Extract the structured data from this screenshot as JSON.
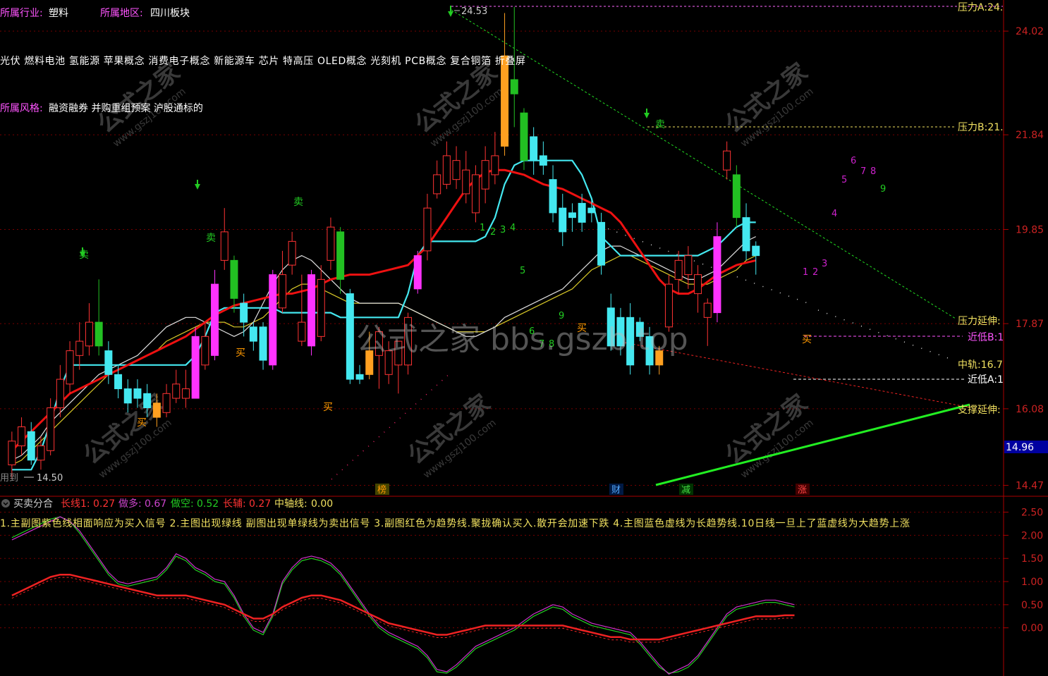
{
  "info": {
    "industry_label": "所属行业:",
    "industry_value": "塑料",
    "region_label": "所属地区:",
    "region_value": "四川板块",
    "concepts": "光伏 燃料电池 氢能源 苹果概念 消费电子概念 新能源车 芯片 特高压 OLED概念 光刻机 PCB概念 复合铜箔 折叠屏",
    "style_label": "所属风格:",
    "style_value": "融资融券 并购重组预案 沪股通标的"
  },
  "colors": {
    "background": "#000000",
    "up_candle": "#ff3333",
    "down_candle": "#44e8f0",
    "buy_bar": "#ff33ff",
    "sell_bar": "#22c022",
    "orange_bar": "#ffa020",
    "ma_red": "#ee1111",
    "ma_cyan": "#44e8f0",
    "ma_white": "#e0e0e0",
    "ma_yellow": "#d8c828",
    "support_green": "#22ee22",
    "axis_red": "#aa0000"
  },
  "main_axis": {
    "ticks": [
      "24.02",
      "21.84",
      "19.85",
      "17.87",
      "16.08",
      "14.47"
    ],
    "current_price": "14.96",
    "top_label": "压力A:24."
  },
  "levels": {
    "pressure_b": "压力B:21.",
    "pressure_ext": "压力延伸:",
    "near_low_b": "近低B:1",
    "mid_rail": "中轨:16.7",
    "near_low_a": "近低A:1",
    "support_ext": "支撑延伸:"
  },
  "annotations": {
    "peak": "24.53",
    "low": "14.50",
    "low_prefix": "用到",
    "buy": "买",
    "sell": "卖",
    "events": [
      "榜",
      "财",
      "减",
      "涨"
    ],
    "green_counts": [
      "1",
      "2",
      "3",
      "4",
      "5",
      "6",
      "7",
      "8",
      "9"
    ],
    "magenta_counts": [
      "1",
      "2",
      "3",
      "4",
      "5",
      "6",
      "7",
      "8",
      "9"
    ]
  },
  "watermarks": {
    "center": "公式之家 bbs.gszb.top",
    "brand": "公式之家",
    "url": "www.gszj100.com"
  },
  "sub_panel": {
    "title": "买卖分合",
    "long_line_label": "长线1:",
    "long_line_value": "0.27",
    "do_long_label": "做多:",
    "do_long_value": "0.67",
    "do_short_label": "做空:",
    "do_short_value": "0.52",
    "long_aux_label": "长辅:",
    "long_aux_value": "0.27",
    "mid_axis_label": "中轴线:",
    "mid_axis_value": "0.00",
    "description": "1.主副图紫色线相面响应为买入信号 2.主图出现绿线 副图出现单绿线为卖出信号 3.副图红色为趋势线.聚拢确认买入.散开会加速下跌 4.主图蓝色虚线为长趋势线.10日线一旦上了蓝虚线为大趋势上涨",
    "ticks": [
      "2.50",
      "2.00",
      "1.50",
      "1.00",
      "0.50",
      "0.00"
    ]
  },
  "chart_data": {
    "type": "candlestick",
    "price_range": [
      14.3,
      24.6
    ],
    "sub_range": [
      -0.98,
      2.6
    ],
    "n_bars": 78,
    "candles": [
      [
        14.9,
        15.4,
        15.6,
        14.6,
        "u"
      ],
      [
        15.3,
        15.7,
        15.9,
        15.1,
        "u"
      ],
      [
        15.6,
        15.0,
        15.8,
        14.9,
        "d"
      ],
      [
        15.0,
        15.3,
        15.5,
        14.8,
        "u"
      ],
      [
        15.2,
        16.1,
        16.3,
        15.1,
        "u"
      ],
      [
        16.1,
        16.7,
        17.0,
        15.9,
        "u"
      ],
      [
        16.6,
        17.3,
        17.5,
        16.4,
        "u"
      ],
      [
        17.2,
        17.5,
        17.9,
        16.9,
        "u"
      ],
      [
        17.4,
        17.9,
        18.3,
        17.2,
        "u"
      ],
      [
        17.9,
        17.4,
        18.8,
        17.2,
        "s"
      ],
      [
        17.3,
        16.8,
        17.5,
        16.6,
        "d"
      ],
      [
        16.8,
        16.5,
        17.0,
        16.3,
        "d"
      ],
      [
        16.5,
        16.2,
        16.7,
        16.0,
        "d"
      ],
      [
        16.3,
        16.5,
        16.7,
        16.1,
        "d"
      ],
      [
        16.4,
        16.1,
        16.6,
        15.9,
        "d"
      ],
      [
        16.2,
        15.9,
        16.4,
        15.7,
        "o"
      ],
      [
        16.0,
        16.4,
        16.6,
        15.9,
        "u"
      ],
      [
        16.3,
        16.6,
        16.9,
        16.2,
        "u"
      ],
      [
        16.5,
        16.3,
        16.9,
        16.1,
        "u"
      ],
      [
        16.3,
        17.6,
        17.8,
        16.3,
        "b"
      ],
      [
        17.0,
        17.6,
        17.9,
        16.9,
        "u"
      ],
      [
        17.2,
        18.7,
        19.0,
        17.1,
        "b"
      ],
      [
        19.2,
        19.8,
        20.3,
        19.0,
        "u"
      ],
      [
        19.2,
        18.4,
        19.3,
        18.1,
        "s"
      ],
      [
        18.3,
        17.9,
        18.5,
        17.6,
        "d"
      ],
      [
        17.8,
        17.5,
        17.9,
        17.3,
        "d"
      ],
      [
        17.8,
        17.1,
        17.9,
        16.9,
        "d"
      ],
      [
        17.0,
        18.9,
        19.0,
        16.9,
        "b"
      ],
      [
        18.2,
        18.9,
        19.4,
        18.1,
        "u"
      ],
      [
        19.1,
        19.6,
        19.8,
        18.9,
        "u"
      ],
      [
        17.9,
        17.5,
        18.9,
        17.4,
        "u"
      ],
      [
        17.4,
        18.9,
        19.0,
        17.2,
        "b"
      ],
      [
        17.6,
        18.8,
        19.1,
        17.5,
        "u"
      ],
      [
        19.2,
        19.9,
        20.1,
        19.0,
        "u"
      ],
      [
        19.8,
        18.8,
        19.9,
        18.5,
        "s"
      ],
      [
        18.5,
        16.7,
        18.6,
        16.6,
        "d"
      ],
      [
        16.7,
        16.8,
        17.0,
        16.6,
        "d"
      ],
      [
        16.8,
        17.3,
        17.7,
        16.7,
        "o"
      ],
      [
        17.2,
        17.7,
        17.8,
        16.5,
        "u"
      ],
      [
        17.3,
        16.8,
        17.5,
        16.6,
        "u"
      ],
      [
        17.5,
        17.0,
        17.5,
        16.4,
        "u"
      ],
      [
        17.0,
        18.0,
        18.1,
        16.8,
        "u"
      ],
      [
        19.3,
        18.6,
        19.4,
        18.5,
        "b"
      ],
      [
        19.4,
        20.3,
        20.6,
        19.2,
        "u"
      ],
      [
        20.6,
        21.0,
        21.3,
        20.5,
        "u"
      ],
      [
        20.8,
        21.4,
        21.7,
        20.7,
        "u"
      ],
      [
        21.3,
        20.9,
        21.6,
        20.7,
        "u"
      ],
      [
        20.6,
        21.1,
        21.5,
        20.4,
        "u"
      ],
      [
        21.0,
        20.2,
        21.2,
        20.0,
        "u"
      ],
      [
        20.7,
        21.3,
        21.6,
        20.4,
        "u"
      ],
      [
        21.0,
        21.4,
        21.9,
        20.8,
        "u"
      ],
      [
        21.6,
        23.5,
        24.4,
        21.4,
        "o"
      ],
      [
        23.0,
        22.7,
        24.53,
        22.0,
        "s"
      ],
      [
        22.3,
        21.3,
        22.4,
        21.1,
        "s"
      ],
      [
        21.8,
        21.3,
        22.0,
        21.0,
        "d"
      ],
      [
        21.4,
        21.2,
        21.7,
        21.0,
        "d"
      ],
      [
        20.9,
        20.2,
        21.2,
        20.0,
        "d"
      ],
      [
        20.3,
        19.8,
        20.6,
        19.5,
        "d"
      ],
      [
        20.2,
        20.1,
        20.4,
        19.8,
        "d"
      ],
      [
        20.4,
        20.0,
        20.6,
        19.8,
        "d"
      ],
      [
        20.2,
        20.3,
        20.5,
        20.0,
        "d"
      ],
      [
        20.0,
        19.1,
        20.2,
        18.9,
        "d"
      ],
      [
        18.2,
        17.4,
        18.5,
        17.3,
        "d"
      ],
      [
        18.0,
        17.4,
        18.2,
        17.2,
        "d"
      ],
      [
        18.0,
        17.0,
        18.3,
        16.8,
        "d"
      ],
      [
        17.9,
        17.6,
        18.0,
        17.5,
        "d"
      ],
      [
        17.6,
        17.0,
        17.8,
        16.8,
        "d"
      ],
      [
        17.0,
        17.3,
        17.4,
        16.8,
        "o"
      ],
      [
        17.8,
        18.7,
        18.9,
        17.7,
        "u"
      ],
      [
        18.8,
        19.2,
        19.4,
        18.5,
        "u"
      ],
      [
        18.9,
        19.3,
        19.5,
        18.6,
        "u"
      ],
      [
        18.9,
        18.5,
        19.1,
        18.1,
        "u"
      ],
      [
        18.3,
        18.0,
        18.4,
        17.4,
        "u"
      ],
      [
        18.1,
        19.7,
        20.0,
        17.9,
        "b"
      ],
      [
        21.1,
        21.5,
        21.7,
        20.9,
        "u"
      ],
      [
        21.0,
        20.1,
        21.2,
        19.9,
        "s"
      ],
      [
        20.1,
        19.4,
        20.4,
        19.2,
        "d"
      ],
      [
        19.5,
        19.3,
        19.6,
        18.9,
        "d"
      ]
    ],
    "ma_red": [
      15.2,
      15.4,
      15.6,
      15.8,
      16.0,
      16.2,
      16.4,
      16.5,
      16.6,
      16.7,
      16.8,
      16.9,
      17.0,
      17.1,
      17.2,
      17.3,
      17.4,
      17.5,
      17.6,
      17.75,
      17.9,
      18.05,
      18.15,
      18.25,
      18.3,
      18.35,
      18.4,
      18.45,
      18.5,
      18.5,
      18.55,
      18.6,
      18.7,
      18.8,
      18.85,
      18.9,
      18.9,
      18.9,
      18.95,
      19.0,
      19.05,
      19.1,
      19.3,
      19.5,
      19.8,
      20.1,
      20.4,
      20.7,
      20.9,
      21.05,
      21.1,
      21.1,
      21.05,
      21.0,
      20.9,
      20.8,
      20.75,
      20.7,
      20.6,
      20.5,
      20.4,
      20.3,
      20.2,
      20.0,
      19.7,
      19.4,
      19.1,
      18.8,
      18.6,
      18.5,
      18.5,
      18.6,
      18.75,
      18.9,
      19.0,
      19.1,
      19.15,
      19.2
    ],
    "ma_cyan": [
      14.8,
      14.8,
      14.8,
      15.2,
      15.8,
      16.5,
      17.0,
      17.0,
      17.0,
      17.0,
      17.0,
      17.0,
      17.0,
      17.0,
      17.0,
      17.0,
      17.0,
      17.0,
      17.0,
      17.2,
      17.6,
      18.1,
      18.2,
      18.2,
      18.2,
      18.2,
      18.2,
      18.2,
      18.1,
      18.1,
      18.1,
      18.1,
      18.1,
      18.1,
      18.0,
      18.0,
      18.0,
      18.0,
      18.0,
      18.0,
      18.0,
      18.5,
      19.3,
      19.6,
      19.6,
      19.6,
      19.6,
      19.6,
      19.6,
      19.7,
      20.1,
      20.8,
      21.2,
      21.3,
      21.3,
      21.3,
      21.3,
      21.3,
      21.3,
      21.0,
      20.5,
      19.7,
      19.5,
      19.3,
      19.3,
      19.3,
      19.3,
      19.3,
      19.3,
      19.3,
      19.3,
      19.3,
      19.4,
      19.5,
      19.7,
      19.9,
      20.0,
      20.0
    ],
    "ma_white": [
      15.0,
      15.1,
      15.3,
      15.5,
      15.8,
      16.0,
      16.2,
      16.4,
      16.6,
      16.8,
      16.9,
      17.0,
      17.1,
      17.2,
      17.4,
      17.6,
      17.8,
      17.9,
      18.0,
      18.0,
      17.9,
      17.8,
      17.7,
      17.6,
      17.7,
      17.9,
      18.3,
      18.7,
      19.0,
      19.2,
      19.3,
      19.2,
      19.0,
      18.8,
      18.6,
      18.4,
      18.3,
      18.3,
      18.3,
      18.3,
      18.3,
      18.2,
      18.1,
      18.0,
      17.9,
      17.8,
      17.7,
      17.6,
      17.6,
      17.7,
      17.8,
      18.0,
      18.1,
      18.2,
      18.3,
      18.4,
      18.5,
      18.6,
      18.8,
      19.0,
      19.2,
      19.4,
      19.5,
      19.5,
      19.4,
      19.3,
      19.2,
      19.1,
      19.0,
      18.9,
      18.8,
      18.8,
      18.9,
      19.0,
      19.2,
      19.4,
      19.6,
      19.7
    ],
    "ma_yellow": [
      14.9,
      15.0,
      15.2,
      15.4,
      15.6,
      15.8,
      16.0,
      16.2,
      16.4,
      16.6,
      16.8,
      16.9,
      17.0,
      17.1,
      17.2,
      17.3,
      17.5,
      17.6,
      17.7,
      17.8,
      17.9,
      17.9,
      17.9,
      17.8,
      17.8,
      17.9,
      18.0,
      18.2,
      18.4,
      18.6,
      18.7,
      18.7,
      18.6,
      18.5,
      18.4,
      18.3,
      18.3,
      18.3,
      18.3,
      18.3,
      18.3,
      18.2,
      18.1,
      18.0,
      17.9,
      17.8,
      17.7,
      17.7,
      17.7,
      17.7,
      17.8,
      17.9,
      18.0,
      18.1,
      18.2,
      18.3,
      18.4,
      18.5,
      18.6,
      18.8,
      19.0,
      19.1,
      19.2,
      19.3,
      19.3,
      19.2,
      19.1,
      19.0,
      18.9,
      18.8,
      18.7,
      18.7,
      18.7,
      18.8,
      18.9,
      19.0,
      19.2,
      19.3
    ],
    "sub_magenta": [
      1.9,
      2.0,
      2.1,
      2.2,
      2.3,
      2.4,
      2.3,
      2.1,
      1.8,
      1.5,
      1.2,
      1.0,
      0.95,
      1.0,
      1.05,
      1.1,
      1.3,
      1.6,
      1.5,
      1.3,
      1.2,
      1.05,
      1.0,
      0.7,
      0.3,
      0.0,
      -0.1,
      0.3,
      1.0,
      1.3,
      1.5,
      1.55,
      1.5,
      1.4,
      1.2,
      0.9,
      0.6,
      0.3,
      0.05,
      -0.1,
      -0.2,
      -0.3,
      -0.4,
      -0.6,
      -0.9,
      -0.95,
      -0.8,
      -0.6,
      -0.4,
      -0.3,
      -0.2,
      -0.1,
      0.0,
      0.15,
      0.3,
      0.4,
      0.5,
      0.45,
      0.3,
      0.2,
      0.1,
      0.05,
      0.0,
      -0.05,
      -0.1,
      -0.3,
      -0.55,
      -0.8,
      -1.0,
      -0.9,
      -0.8,
      -0.6,
      -0.3,
      0.0,
      0.3,
      0.45,
      0.5,
      0.55,
      0.6,
      0.6,
      0.55,
      0.5
    ],
    "sub_green": [
      1.95,
      2.05,
      2.15,
      2.25,
      2.35,
      2.4,
      2.3,
      2.05,
      1.75,
      1.45,
      1.15,
      0.95,
      0.9,
      0.95,
      1.0,
      1.05,
      1.25,
      1.55,
      1.45,
      1.25,
      1.15,
      1.0,
      0.95,
      0.65,
      0.25,
      -0.05,
      -0.15,
      0.25,
      0.95,
      1.25,
      1.45,
      1.5,
      1.45,
      1.35,
      1.15,
      0.85,
      0.55,
      0.25,
      0.0,
      -0.15,
      -0.25,
      -0.35,
      -0.45,
      -0.65,
      -0.95,
      -0.98,
      -0.85,
      -0.65,
      -0.45,
      -0.35,
      -0.25,
      -0.15,
      -0.05,
      0.1,
      0.25,
      0.35,
      0.45,
      0.4,
      0.25,
      0.15,
      0.05,
      0.0,
      -0.05,
      -0.1,
      -0.15,
      -0.35,
      -0.6,
      -0.85,
      -0.98,
      -0.95,
      -0.85,
      -0.65,
      -0.35,
      -0.05,
      0.25,
      0.4,
      0.45,
      0.5,
      0.55,
      0.55,
      0.5,
      0.45
    ],
    "sub_red": [
      0.7,
      0.8,
      0.9,
      1.0,
      1.1,
      1.15,
      1.15,
      1.1,
      1.05,
      1.0,
      0.95,
      0.9,
      0.85,
      0.8,
      0.75,
      0.7,
      0.7,
      0.7,
      0.7,
      0.65,
      0.6,
      0.55,
      0.5,
      0.4,
      0.3,
      0.2,
      0.2,
      0.3,
      0.45,
      0.55,
      0.65,
      0.7,
      0.7,
      0.65,
      0.6,
      0.5,
      0.4,
      0.3,
      0.2,
      0.1,
      0.05,
      0.0,
      -0.05,
      -0.1,
      -0.15,
      -0.15,
      -0.1,
      -0.05,
      0.0,
      0.05,
      0.05,
      0.05,
      0.05,
      0.05,
      0.05,
      0.05,
      0.05,
      0.05,
      0.0,
      -0.05,
      -0.1,
      -0.15,
      -0.2,
      -0.2,
      -0.25,
      -0.25,
      -0.25,
      -0.25,
      -0.2,
      -0.15,
      -0.1,
      -0.05,
      0.0,
      0.05,
      0.1,
      0.15,
      0.2,
      0.25,
      0.25,
      0.25,
      0.27,
      0.27
    ]
  }
}
